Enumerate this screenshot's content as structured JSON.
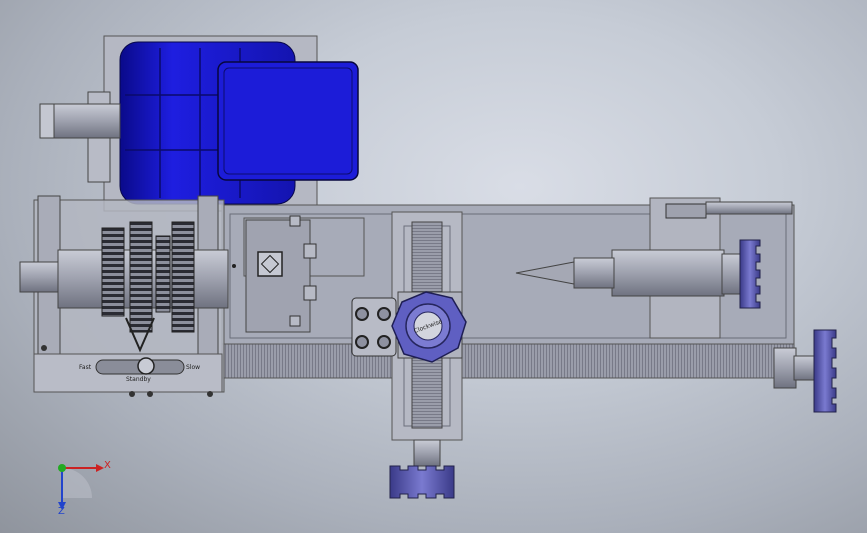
{
  "gearbox": {
    "fast_label": "Fast",
    "standby_label": "Standby",
    "slow_label": "Slow"
  },
  "toolpost": {
    "knob_label": "Clockwise"
  },
  "triad": {
    "x_label": "X",
    "z_label": "Z"
  },
  "colors": {
    "motor_blue": "#1a1ad6",
    "knob_purple": "#5c5cb0",
    "metal_gray": "#a9acb8",
    "x_axis": "#cc2222",
    "y_axis": "#22aa22",
    "z_axis": "#2244cc"
  }
}
